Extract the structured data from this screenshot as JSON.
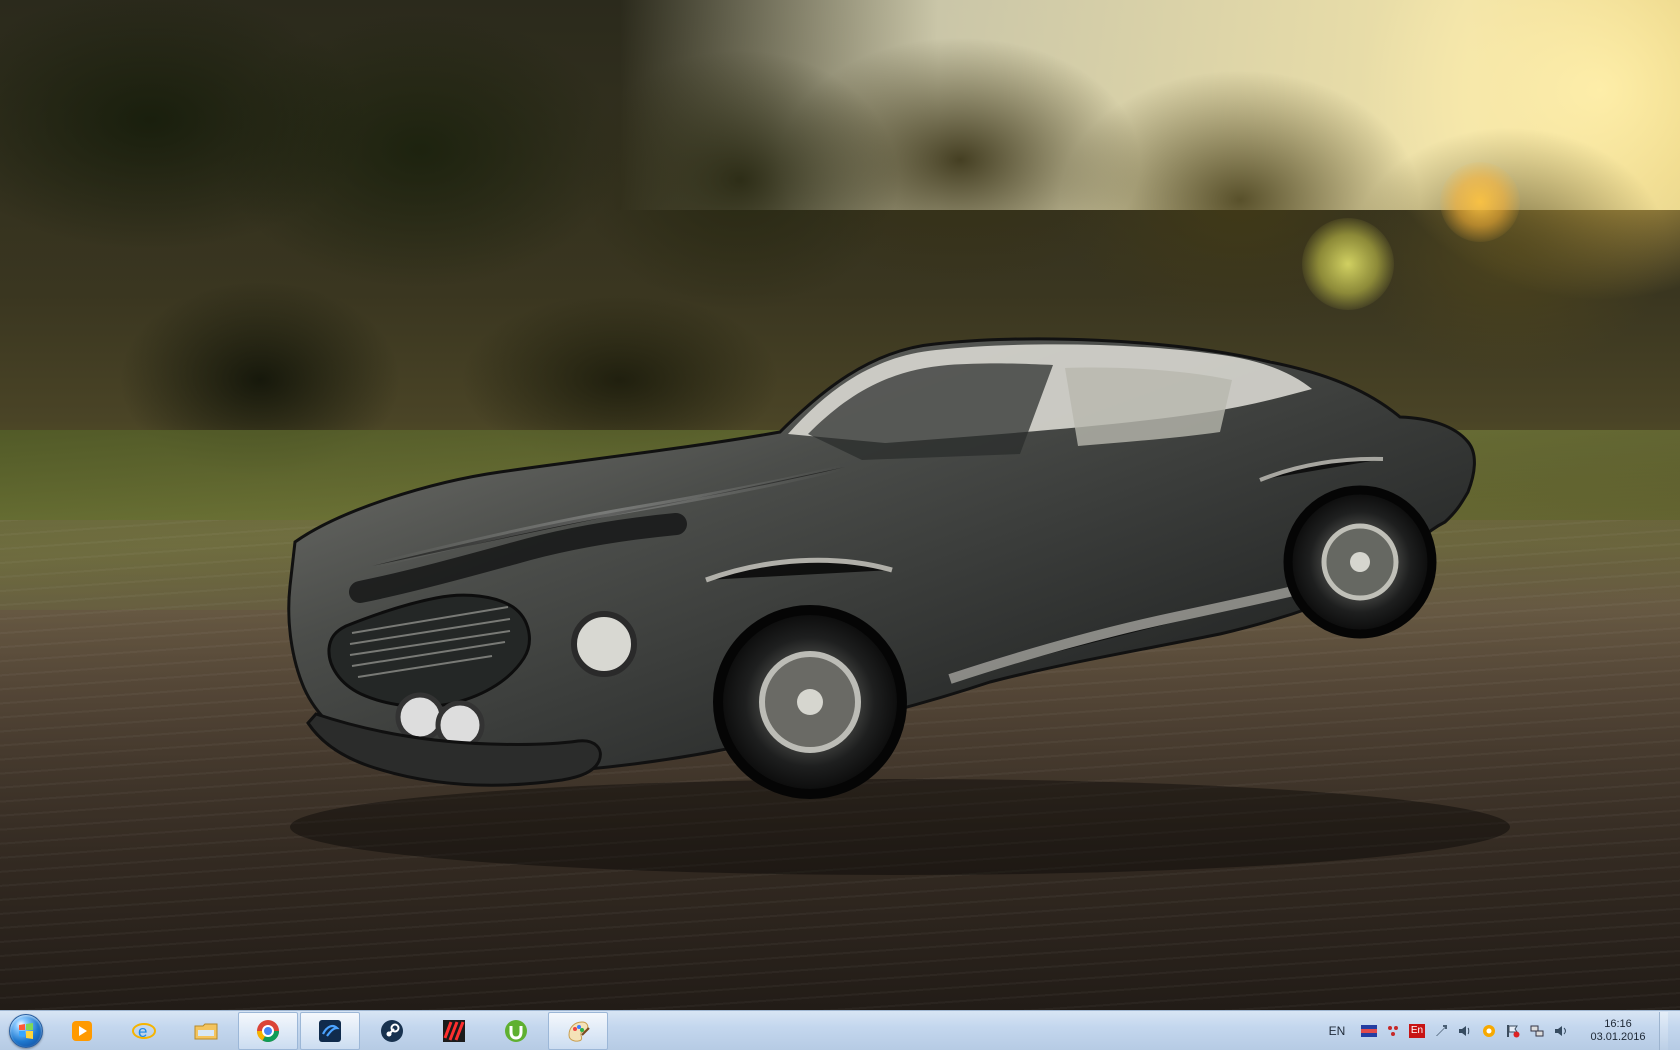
{
  "desktop": {
    "wallpaper_label": "",
    "wallpaper_subject": "",
    "taskbar_color": "#c4d7ee",
    "accent_color": "#1f79cf"
  },
  "taskbar": {
    "pinned": [
      {
        "name": "media-player",
        "icon": "play-icon",
        "label": ""
      },
      {
        "name": "internet-explorer",
        "icon": "ie-icon",
        "label": ""
      },
      {
        "name": "file-explorer",
        "icon": "folder-icon",
        "label": ""
      },
      {
        "name": "chrome",
        "icon": "chrome-icon",
        "label": ""
      },
      {
        "name": "app-blue",
        "icon": "blue-app-icon",
        "label": ""
      },
      {
        "name": "steam",
        "icon": "steam-icon",
        "label": ""
      },
      {
        "name": "app-striped",
        "icon": "striped-app-icon",
        "label": ""
      },
      {
        "name": "utorrent",
        "icon": "utorrent-icon",
        "label": ""
      },
      {
        "name": "paint",
        "icon": "paint-icon",
        "label": ""
      }
    ],
    "tray": {
      "language": "EN",
      "icons": [
        "flag-icon",
        "network-red-icon",
        "keyboard-en-icon",
        "arrow-icon",
        "speaker-icon",
        "orange-app-icon",
        "warning-flag-icon",
        "network-icon",
        "volume-icon"
      ],
      "keyboard_label": "En",
      "time": "16:16",
      "date": "03.01.2016"
    }
  }
}
